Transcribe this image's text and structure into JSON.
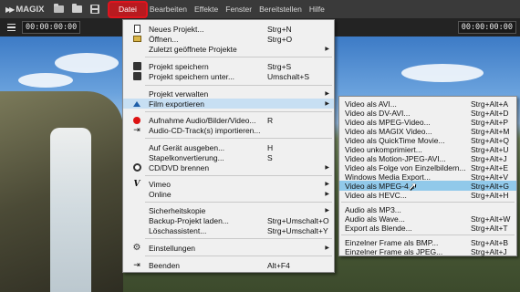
{
  "app": {
    "name": "MAGIX"
  },
  "menubar": [
    {
      "label": "Datei",
      "active": true
    },
    {
      "label": "Bearbeiten"
    },
    {
      "label": "Effekte"
    },
    {
      "label": "Fenster"
    },
    {
      "label": "Bereitstellen"
    },
    {
      "label": "Hilfe"
    }
  ],
  "toolbar": {
    "timecode_left": "00:00:00:00",
    "timecode_right": "00:00:00:00"
  },
  "file_menu": {
    "items": [
      {
        "label": "Neues Projekt...",
        "shortcut": "Strg+N",
        "icon": "new-document-icon"
      },
      {
        "label": "Öffnen...",
        "shortcut": "Strg+O",
        "icon": "open-folder-icon"
      },
      {
        "label": "Zuletzt geöffnete Projekte",
        "submenu": true
      },
      {
        "label": "Projekt speichern",
        "shortcut": "Strg+S",
        "icon": "save-disk-icon"
      },
      {
        "label": "Projekt speichern unter...",
        "shortcut": "Umschalt+S",
        "icon": "save-as-disk-icon"
      },
      {
        "label": "Projekt verwalten",
        "submenu": true
      },
      {
        "label": "Film exportieren",
        "submenu": true,
        "icon": "export-icon",
        "highlighted": true
      },
      {
        "label": "Aufnahme Audio/Bilder/Video...",
        "shortcut": "R",
        "icon": "record-icon"
      },
      {
        "label": "Audio-CD-Track(s) importieren...",
        "icon": "audio-cd-import-icon"
      },
      {
        "label": "Auf Gerät ausgeben...",
        "shortcut": "H"
      },
      {
        "label": "Stapelkonvertierung...",
        "shortcut": "S"
      },
      {
        "label": "CD/DVD brennen",
        "submenu": true,
        "icon": "disc-burn-icon"
      },
      {
        "label": "Vimeo",
        "submenu": true,
        "icon": "vimeo-icon"
      },
      {
        "label": "Online",
        "submenu": true
      },
      {
        "label": "Sicherheitskopie",
        "submenu": true
      },
      {
        "label": "Backup-Projekt laden...",
        "shortcut": "Strg+Umschalt+O"
      },
      {
        "label": "Löschassistent...",
        "shortcut": "Strg+Umschalt+Y"
      },
      {
        "label": "Einstellungen",
        "submenu": true,
        "icon": "gear-icon"
      },
      {
        "label": "Beenden",
        "shortcut": "Alt+F4",
        "icon": "exit-icon"
      }
    ]
  },
  "export_submenu": {
    "items": [
      {
        "label": "Video als AVI...",
        "shortcut": "Strg+Alt+A"
      },
      {
        "label": "Video als DV-AVI...",
        "shortcut": "Strg+Alt+D"
      },
      {
        "label": "Video als MPEG-Video...",
        "shortcut": "Strg+Alt+P"
      },
      {
        "label": "Video als MAGIX Video...",
        "shortcut": "Strg+Alt+M"
      },
      {
        "label": "Video als QuickTime Movie...",
        "shortcut": "Strg+Alt+Q"
      },
      {
        "label": "Video unkomprimiert...",
        "shortcut": "Strg+Alt+U"
      },
      {
        "label": "Video als Motion-JPEG-AVI...",
        "shortcut": "Strg+Alt+J"
      },
      {
        "label": "Video als Folge von Einzelbildern...",
        "shortcut": "Strg+Alt+E"
      },
      {
        "label": "Windows Media Export...",
        "shortcut": "Strg+Alt+V"
      },
      {
        "label": "Video als MPEG-4...",
        "shortcut": "Strg+Alt+G",
        "highlighted": true
      },
      {
        "label": "Video als HEVC...",
        "shortcut": "Strg+Alt+H"
      },
      {
        "label": "Audio als MP3...",
        "shortcut": ""
      },
      {
        "label": "Audio als Wave...",
        "shortcut": "Strg+Alt+W"
      },
      {
        "label": "Export als Blende...",
        "shortcut": "Strg+Alt+T"
      },
      {
        "label": "Einzelner Frame als BMP...",
        "shortcut": "Strg+Alt+B"
      },
      {
        "label": "Einzelner Frame als JPEG...",
        "shortcut": "Strg+Alt+J"
      }
    ]
  },
  "colors": {
    "highlight_box": "#e0141e",
    "menu_hover": "#c7dff3",
    "submenu_selected": "#91c9ea"
  }
}
